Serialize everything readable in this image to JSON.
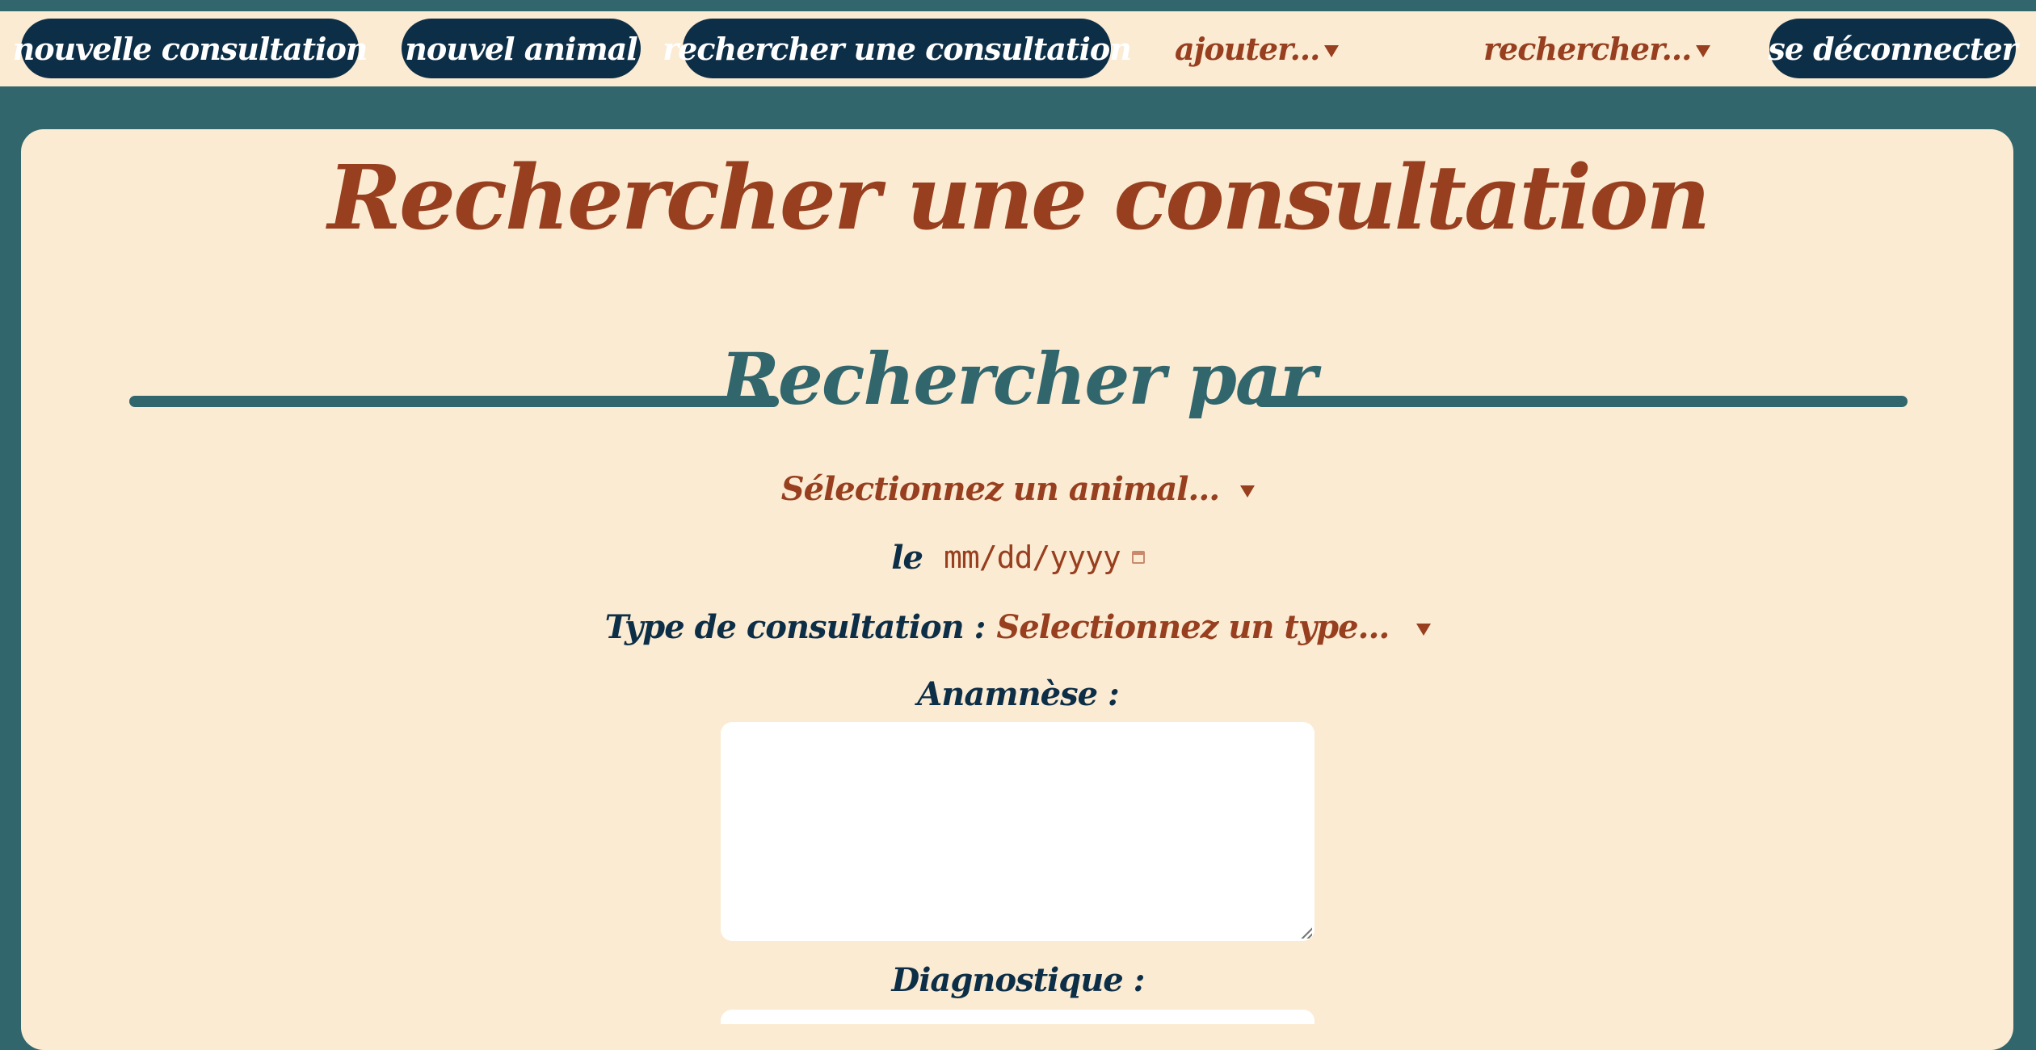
{
  "nav": {
    "new_consultation": "nouvelle consultation",
    "new_animal": "nouvel animal",
    "search_consultation": "rechercher une consultation",
    "add_menu": "ajouter...",
    "search_menu": "rechercher...",
    "logout": "se déconnecter"
  },
  "page": {
    "title": "Rechercher une consultation",
    "section_title": "Rechercher par"
  },
  "form": {
    "animal_select": "Sélectionnez un animal...",
    "date_label": "le",
    "date_placeholder": "mm/dd/yyyy",
    "type_label": "Type de consultation :",
    "type_select": "Selectionnez un type...",
    "anamnesis_label": "Anamnèse :",
    "diagnosis_label": "Diagnostique :"
  },
  "colors": {
    "background": "#31666d",
    "panel": "#fbebd3",
    "navy": "#0d2e47",
    "rust": "#973f1f",
    "teal": "#31666d"
  },
  "icons": [
    "chevron-down-icon",
    "calendar-icon",
    "resize-grip-icon"
  ]
}
